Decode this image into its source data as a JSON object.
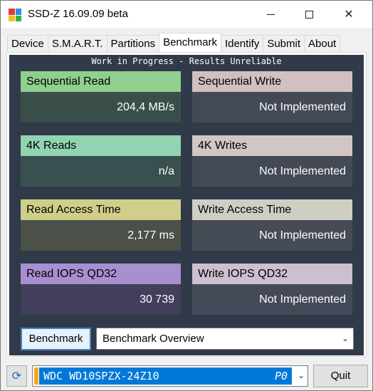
{
  "window": {
    "title": "SSD-Z 16.09.09 beta",
    "icon_colors": [
      "#e23a2e",
      "#2f8ee0",
      "#f5c026",
      "#36b04a"
    ]
  },
  "tabs": [
    {
      "label": "Device",
      "active": false
    },
    {
      "label": "S.M.A.R.T.",
      "active": false
    },
    {
      "label": "Partitions",
      "active": false
    },
    {
      "label": "Benchmark",
      "active": true
    },
    {
      "label": "Identify",
      "active": false
    },
    {
      "label": "Submit",
      "active": false
    },
    {
      "label": "About",
      "active": false
    }
  ],
  "banner": "Work in Progress - Results Unreliable",
  "cards": {
    "seq_read": {
      "label": "Sequential Read",
      "value": "204,4 MB/s",
      "head_color": "#91cf8e",
      "body_color": "#3a4f4a"
    },
    "seq_write": {
      "label": "Sequential Write",
      "value": "Not Implemented",
      "head_color": "#d2c0c0",
      "body_color": "#434a55"
    },
    "k4_read": {
      "label": "4K Reads",
      "value": "n/a",
      "head_color": "#92d3b2",
      "body_color": "#3a5050"
    },
    "k4_write": {
      "label": "4K Writes",
      "value": "Not Implemented",
      "head_color": "#d2c6c4",
      "body_color": "#434a55"
    },
    "read_access": {
      "label": "Read Access Time",
      "value": "2,177 ms",
      "head_color": "#d0cf8a",
      "body_color": "#4b5049"
    },
    "write_access": {
      "label": "Write Access Time",
      "value": "Not Implemented",
      "head_color": "#cdcfc3",
      "body_color": "#464c55"
    },
    "read_iops": {
      "label": "Read IOPS QD32",
      "value": "30 739",
      "head_color": "#a78fd0",
      "body_color": "#413f5c"
    },
    "write_iops": {
      "label": "Write IOPS QD32",
      "value": "Not Implemented",
      "head_color": "#cbbfd0",
      "body_color": "#454a58"
    }
  },
  "controls": {
    "benchmark_button": "Benchmark",
    "overview_select": "Benchmark Overview",
    "drive_name": "WDC WD10SPZX-24Z10",
    "drive_port": "P0",
    "quit_button": "Quit"
  }
}
